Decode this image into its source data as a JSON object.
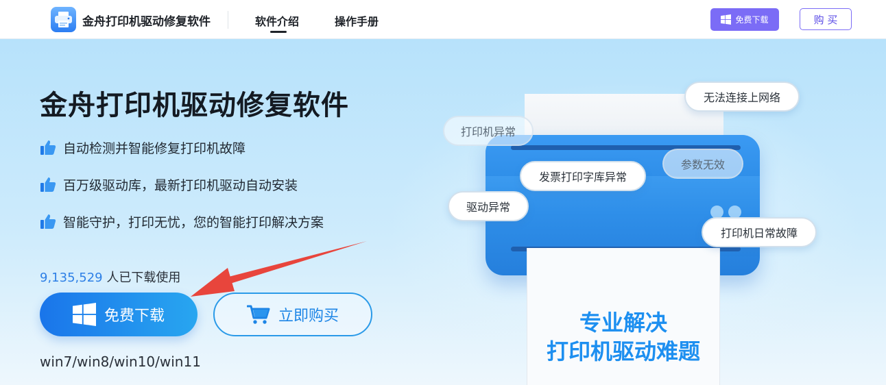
{
  "nav": {
    "brand": "金舟打印机驱动修复软件",
    "links": [
      {
        "label": "软件介绍",
        "active": true
      },
      {
        "label": "操作手册",
        "active": false
      }
    ],
    "download_label": "免费下载",
    "buy_label": "购 买"
  },
  "hero": {
    "title": "金舟打印机驱动修复软件",
    "features": [
      "自动检测并智能修复打印机故障",
      "百万级驱动库，最新打印机驱动自动安装",
      "智能守护，打印无忧，您的智能打印解决方案"
    ],
    "download_count": "9,135,529",
    "download_count_suffix": " 人已下载使用",
    "download_button": "免费下载",
    "buy_button": "立即购买",
    "os_support": "win7/win8/win10/win11"
  },
  "illustration": {
    "bubbles": [
      "无法连接上网络",
      "打印机异常",
      "参数无效",
      "发票打印字库异常",
      "驱动异常",
      "打印机日常故障"
    ],
    "paper_line1": "专业解决",
    "paper_line2": "打印机驱动难题"
  },
  "colors": {
    "accent_purple": "#7b6cf6",
    "accent_blue": "#1a75ea",
    "count_blue": "#2d7fe6",
    "arrow_red": "#e8453c"
  },
  "icons": {
    "logo": "printer-icon",
    "windows": "windows-icon",
    "cart": "cart-icon",
    "thumb": "thumbs-up-icon"
  }
}
